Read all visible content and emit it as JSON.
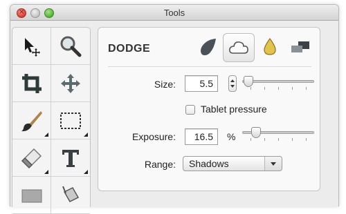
{
  "window": {
    "title": "Tools"
  },
  "tools": [
    {
      "icon": "move-selection-arrow-icon",
      "has_submenu": false
    },
    {
      "icon": "magnifier-icon",
      "has_submenu": false
    },
    {
      "icon": "crop-icon",
      "has_submenu": false
    },
    {
      "icon": "move-arrows-icon",
      "has_submenu": false
    },
    {
      "icon": "paintbrush-icon",
      "has_submenu": true
    },
    {
      "icon": "rectangle-select-icon",
      "has_submenu": true
    },
    {
      "icon": "eraser-icon",
      "has_submenu": true
    },
    {
      "icon": "text-tool-icon",
      "has_submenu": true
    },
    {
      "icon": "rectangle-shape-icon",
      "has_submenu": false
    },
    {
      "icon": "paint-bucket-icon",
      "has_submenu": false
    }
  ],
  "panel": {
    "title": "DODGE",
    "modes": [
      {
        "icon": "burn-icon",
        "selected": false
      },
      {
        "icon": "dodge-cloud-icon",
        "selected": true
      },
      {
        "icon": "sponge-drop-icon",
        "selected": false
      },
      {
        "icon": "smudge-icon",
        "selected": false
      }
    ],
    "size": {
      "label": "Size:",
      "value": "5.5",
      "slider_fraction": 0.02
    },
    "tablet_pressure": {
      "label": "Tablet pressure",
      "checked": false
    },
    "exposure": {
      "label": "Exposure:",
      "value": "16.5",
      "unit": "%",
      "slider_fraction": 0.14
    },
    "range": {
      "label": "Range:",
      "value": "Shadows"
    }
  },
  "colors": {
    "accent_dark": "#4a4a4a",
    "panel_bg": "#f9f9f9",
    "window_bg": "#ececec"
  }
}
